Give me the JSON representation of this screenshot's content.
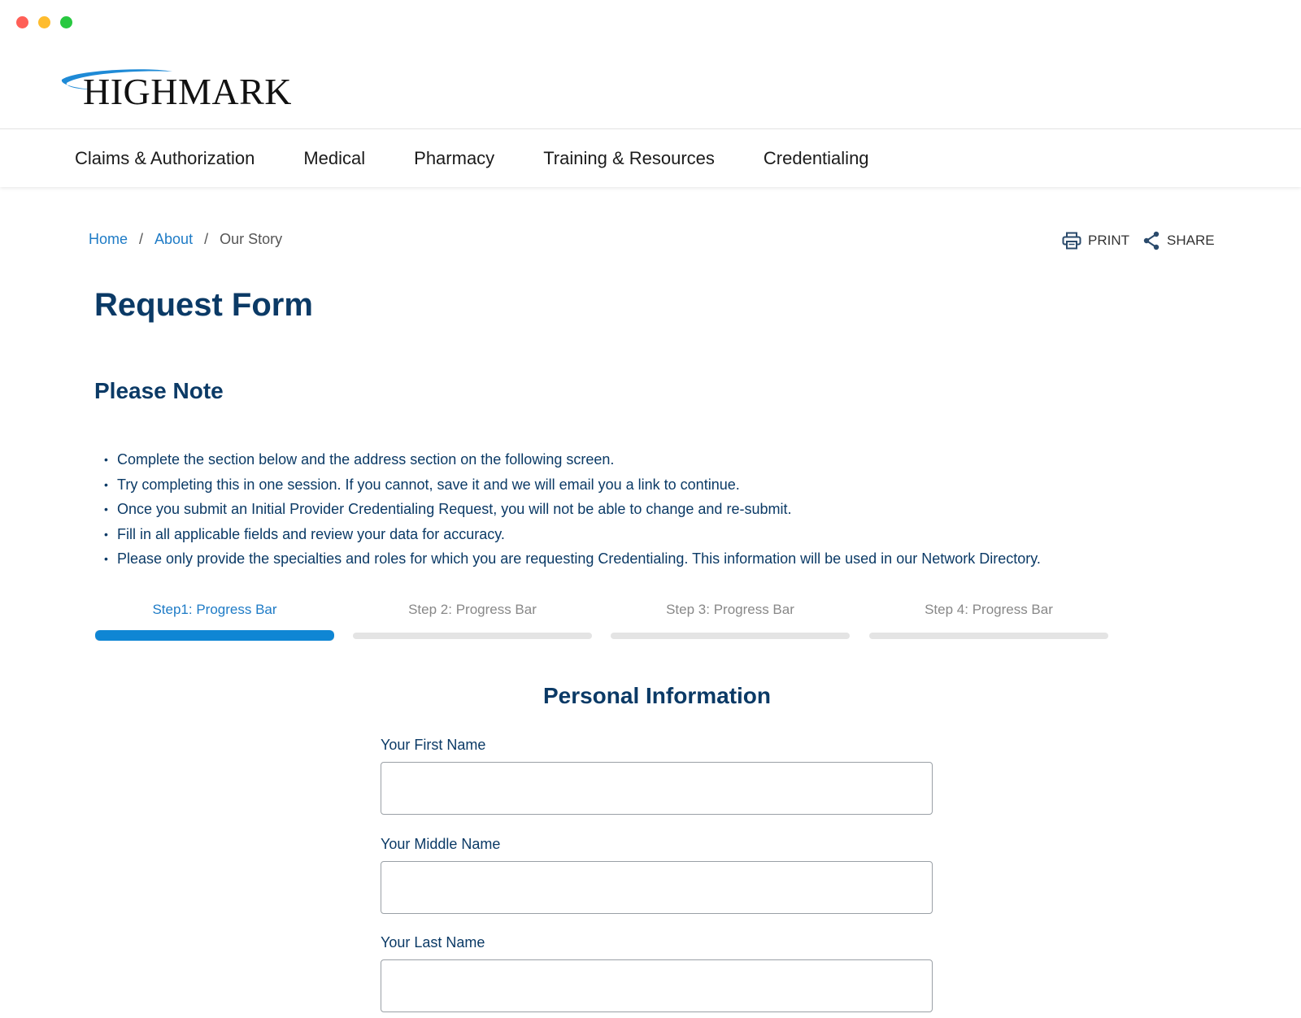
{
  "window": {
    "controls": [
      "close",
      "minimize",
      "maximize"
    ]
  },
  "brand": {
    "logo_text": "HIGHMARK",
    "accent_color": "#1e7bc6"
  },
  "nav": {
    "items": [
      {
        "label": "Claims & Authorization"
      },
      {
        "label": "Medical"
      },
      {
        "label": "Pharmacy"
      },
      {
        "label": "Training & Resources"
      },
      {
        "label": "Credentialing"
      }
    ]
  },
  "breadcrumb": {
    "home": "Home",
    "about": "About",
    "current": "Our Story",
    "separator": "/"
  },
  "actions": {
    "print": "PRINT",
    "share": "SHARE"
  },
  "page": {
    "title": "Request Form"
  },
  "note": {
    "title": "Please Note",
    "items": [
      "Complete the section below and the address section on the following screen.",
      "Try completing this in one session. If you cannot, save it and we will email you a link to continue.",
      "Once you submit an Initial Provider Credentialing Request, you will not be able to change and re-submit.",
      "Fill in all applicable fields and review your data for accuracy.",
      "Please only provide the specialties and roles for which you are requesting Credentialing. This information will be used in our Network Directory."
    ]
  },
  "steps": [
    {
      "label": "Step1: Progress Bar",
      "progress": 1.0,
      "active": true
    },
    {
      "label": "Step 2: Progress Bar",
      "progress": 0,
      "active": false
    },
    {
      "label": "Step 3: Progress Bar",
      "progress": 0,
      "active": false
    },
    {
      "label": "Step 4: Progress Bar",
      "progress": 0,
      "active": false
    }
  ],
  "form": {
    "title": "Personal Information",
    "first_name": {
      "label": "Your First Name",
      "value": "",
      "placeholder": ""
    },
    "middle_name": {
      "label": "Your Middle Name",
      "value": "",
      "placeholder": ""
    },
    "last_name": {
      "label": "Your Last Name",
      "value": "",
      "placeholder": ""
    }
  }
}
